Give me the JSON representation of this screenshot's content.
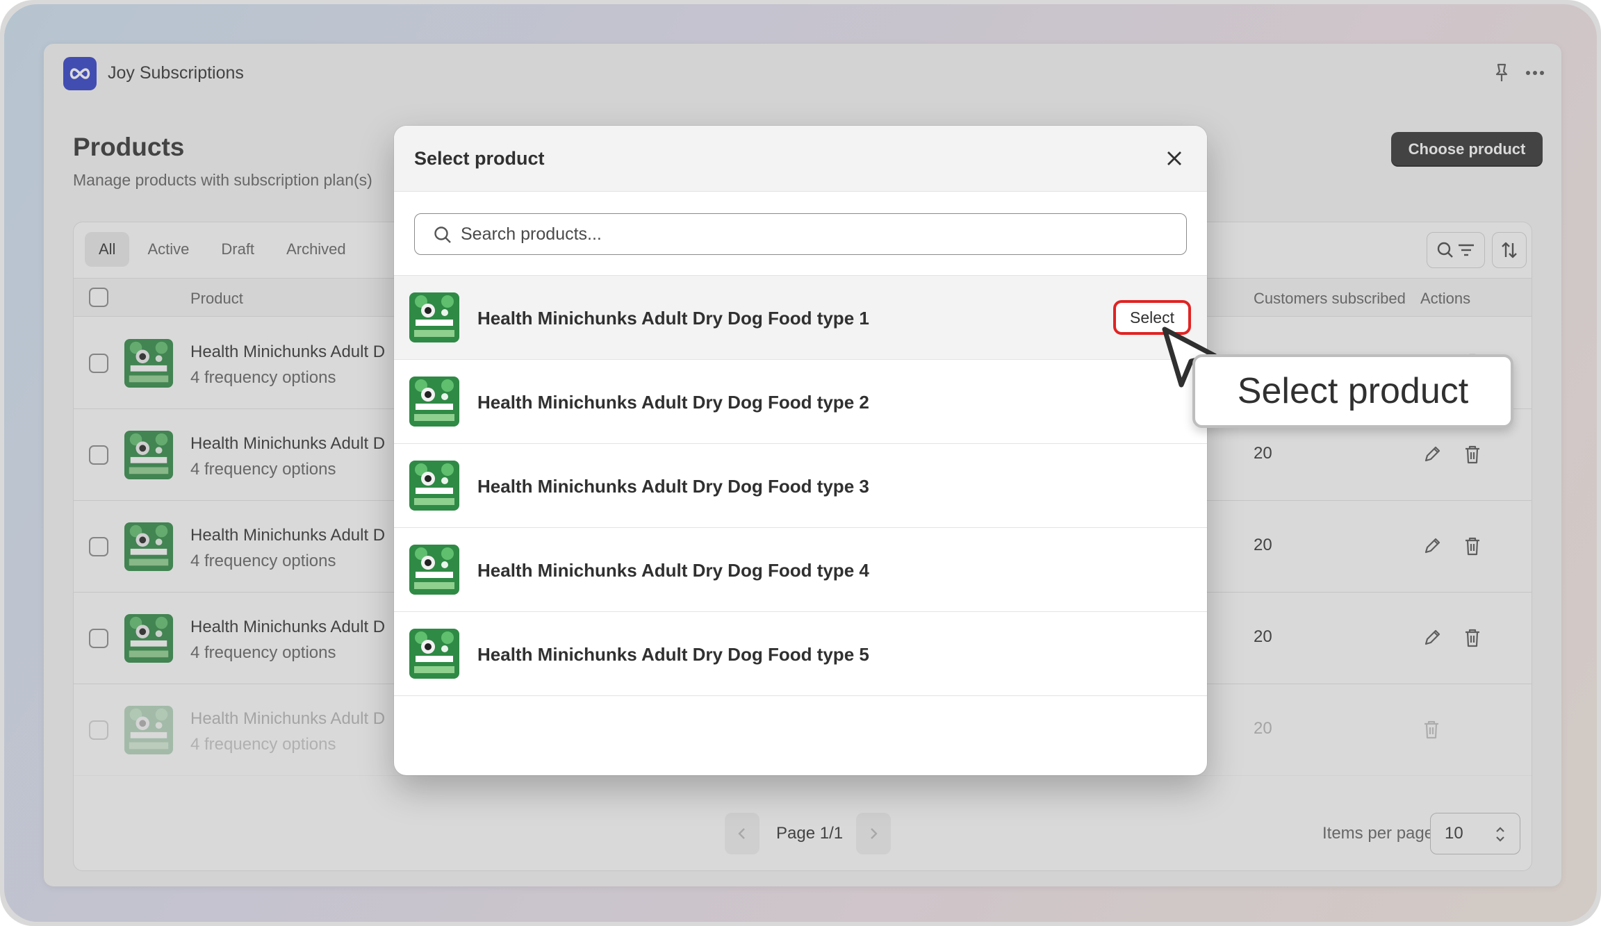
{
  "app": {
    "name": "Joy Subscriptions"
  },
  "page": {
    "title": "Products",
    "subtitle": "Manage products with subscription plan(s)",
    "choose_button": "Choose product"
  },
  "tabs": [
    "All",
    "Active",
    "Draft",
    "Archived"
  ],
  "table": {
    "columns": {
      "product": "Product",
      "customers": "Customers subscribed",
      "actions": "Actions"
    },
    "rows": [
      {
        "name": "Health Minichunks Adult D",
        "freq": "4 frequency options",
        "subs": ""
      },
      {
        "name": "Health Minichunks Adult D",
        "freq": "4 frequency options",
        "subs": "20"
      },
      {
        "name": "Health Minichunks Adult D",
        "freq": "4 frequency options",
        "subs": "20"
      },
      {
        "name": "Health Minichunks Adult D",
        "freq": "4 frequency options",
        "subs": "20"
      },
      {
        "name": "Health Minichunks Adult D",
        "freq": "4 frequency options",
        "subs": "20"
      }
    ]
  },
  "pagination": {
    "page_text": "Page 1/1",
    "items_label": "Items per page",
    "items_value": "10"
  },
  "modal": {
    "title": "Select product",
    "search_placeholder": "Search products...",
    "select_label": "Select",
    "products": [
      "Health Minichunks Adult Dry Dog Food type 1",
      "Health Minichunks Adult Dry Dog Food type 2",
      "Health Minichunks Adult Dry Dog Food type 3",
      "Health Minichunks Adult Dry Dog Food type 4",
      "Health Minichunks Adult Dry Dog Food type 5"
    ]
  },
  "callout": {
    "text": "Select product"
  },
  "colors": {
    "brand": "#2f3ec9",
    "highlight": "#e02424",
    "product_green": "#2f8a45"
  },
  "icons": [
    "infinity-logo-icon",
    "pin-icon",
    "more-icon",
    "search-icon",
    "filter-icon",
    "sort-icon",
    "close-icon",
    "edit-icon",
    "trash-icon",
    "chevron-left-icon",
    "chevron-right-icon",
    "stepper-icon",
    "cursor-icon"
  ]
}
